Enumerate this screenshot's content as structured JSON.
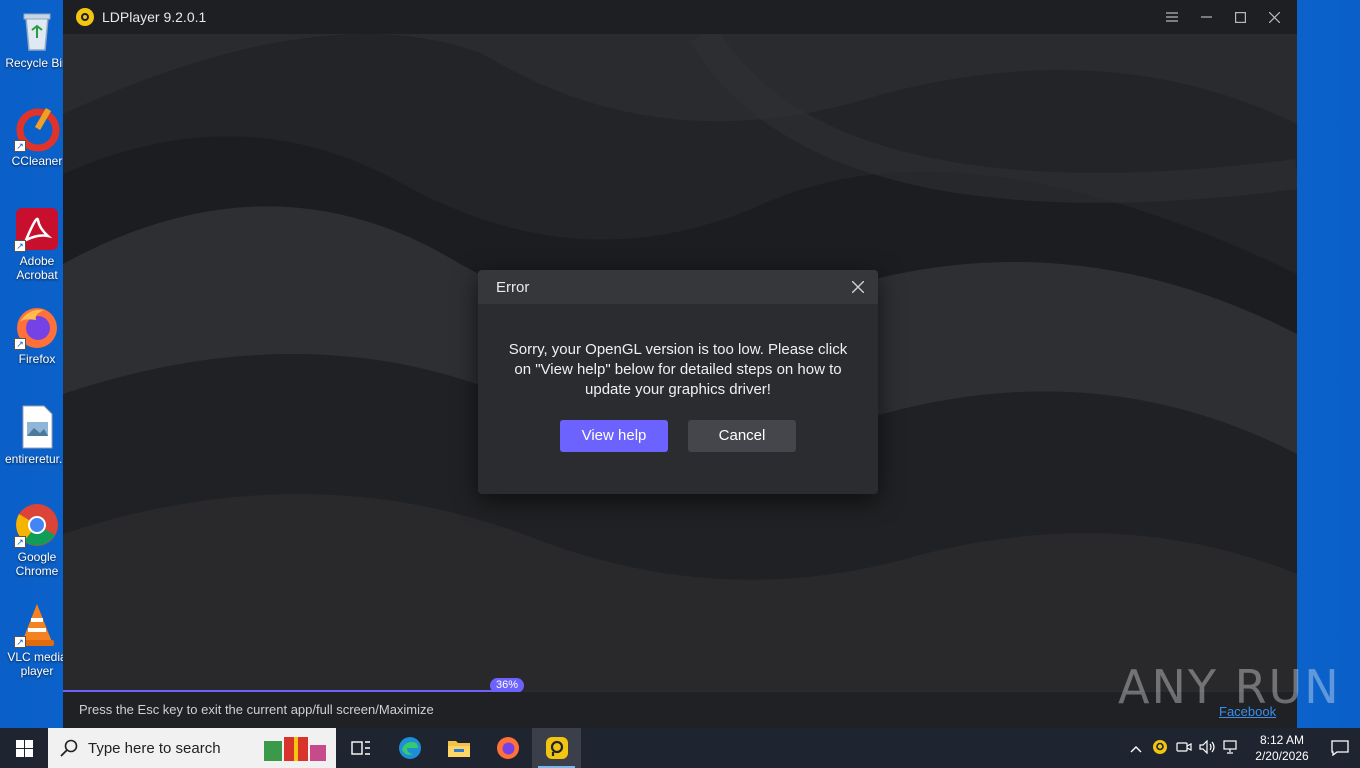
{
  "desktop": {
    "icons": [
      {
        "label": "Recycle Bin",
        "icon": "recycle-bin-icon"
      },
      {
        "label": "CCleaner",
        "icon": "ccleaner-icon"
      },
      {
        "label": "Adobe\nAcrobat",
        "icon": "acrobat-icon"
      },
      {
        "label": "Firefox",
        "icon": "firefox-icon"
      },
      {
        "label": "entireretur...",
        "icon": "image-file-icon"
      },
      {
        "label": "Google\nChrome",
        "icon": "chrome-icon"
      },
      {
        "label": "VLC media\nplayer",
        "icon": "vlc-icon"
      }
    ]
  },
  "window": {
    "title": "LDPlayer 9.2.0.1",
    "controls": [
      "menu-icon",
      "minimize-icon",
      "maximize-icon",
      "close-icon"
    ]
  },
  "dialog": {
    "title": "Error",
    "message": "Sorry, your OpenGL version is too low. Please click on \"View help\" below for detailed steps on how to update your graphics driver!",
    "primary_button": "View help",
    "secondary_button": "Cancel"
  },
  "loading": {
    "progress_label": "36%",
    "progress": 0.36
  },
  "statusbar": {
    "hint": "Press the Esc key to exit the current app/full screen/Maximize"
  },
  "watermark": {
    "brand": "ANY RUN",
    "link": "Facebook"
  },
  "taskbar": {
    "search_placeholder": "Type here to search",
    "apps": [
      "task-view-icon",
      "edge-icon",
      "file-explorer-icon",
      "firefox-icon",
      "ldplayer-icon"
    ],
    "clock_time": "8:12 AM",
    "clock_date": "2/20/2026"
  },
  "colors": {
    "accent": "#6c63ff",
    "window_bg": "#1b1c1f",
    "dialog_bg": "#2b2c30",
    "desktop_bg": "#1a78e0",
    "taskbar_bg": "#1f2530"
  }
}
